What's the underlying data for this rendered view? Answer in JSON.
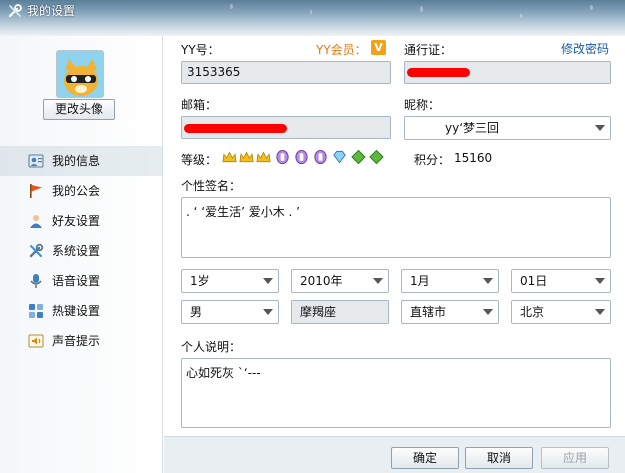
{
  "window": {
    "title": "我的设置",
    "title_icon": "wrench-icon"
  },
  "sidebar": {
    "change_avatar_label": "更改头像",
    "items": [
      {
        "label": "我的信息",
        "icon": "user-card-icon",
        "active": true
      },
      {
        "label": "我的公会",
        "icon": "flag-icon",
        "active": false
      },
      {
        "label": "好友设置",
        "icon": "friend-icon",
        "active": false
      },
      {
        "label": "系统设置",
        "icon": "tools-icon",
        "active": false
      },
      {
        "label": "语音设置",
        "icon": "microphone-icon",
        "active": false
      },
      {
        "label": "热键设置",
        "icon": "hotkey-icon",
        "active": false
      },
      {
        "label": "声音提示",
        "icon": "sound-icon",
        "active": false
      }
    ]
  },
  "profile": {
    "yy_label": "YY号：",
    "yy_value": "3153365",
    "vip_label": "YY会员：",
    "vip_badge": "V",
    "pass_label": "通行证：",
    "change_password": "修改密码",
    "email_label": "邮箱：",
    "nickname_label": "昵称：",
    "nickname_value": "yy‘梦三回",
    "level_label": "等级：",
    "points_label": "积分：",
    "points_value": "15160",
    "signature_label": "个性签名：",
    "signature_value": ". ‘ ‘爱生活’ 爱小木 . ’",
    "age": "1岁",
    "year": "2010年",
    "month": "1月",
    "day": "01日",
    "gender": "男",
    "zodiac": "摩羯座",
    "city": "直辖市",
    "region": "北京",
    "bio_label": "个人说明：",
    "bio_value": "心如死灰 `‘---"
  },
  "buttons": {
    "ok": "确定",
    "cancel": "取消",
    "apply": "应用"
  },
  "colors": {
    "accent_link": "#1a5aa8",
    "vip_orange": "#e07a1a",
    "redaction": "#ff0000"
  }
}
